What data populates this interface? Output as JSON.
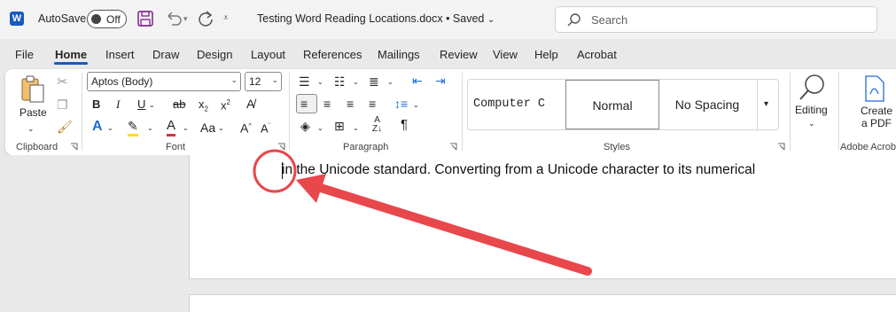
{
  "titlebar": {
    "autosave_label": "AutoSave",
    "autosave_state": "Off",
    "document_title": "Testing Word Reading Locations.docx • Saved",
    "search_placeholder": "Search"
  },
  "tabs": [
    "File",
    "Home",
    "Insert",
    "Draw",
    "Design",
    "Layout",
    "References",
    "Mailings",
    "Review",
    "View",
    "Help",
    "Acrobat"
  ],
  "active_tab": "Home",
  "ribbon": {
    "clipboard": {
      "paste_label": "Paste",
      "group_label": "Clipboard"
    },
    "font": {
      "font_name": "Aptos (Body)",
      "font_size": "12",
      "group_label": "Font",
      "case_label": "Aa"
    },
    "paragraph": {
      "group_label": "Paragraph"
    },
    "styles": {
      "items": [
        "Computer C",
        "Normal",
        "No Spacing"
      ],
      "group_label": "Styles"
    },
    "editing": {
      "label": "Editing"
    },
    "adobe": {
      "label_line1": "Create",
      "label_line2": "a PDF",
      "group_label": "Adobe Acrobat"
    }
  },
  "document": {
    "text": "in the Unicode standard. Converting from a Unicode character to its numerical"
  },
  "colors": {
    "word_blue": "#185abd",
    "annotation_red": "#e8474c",
    "highlight_yellow": "#ffe000",
    "font_red": "#d13438"
  }
}
